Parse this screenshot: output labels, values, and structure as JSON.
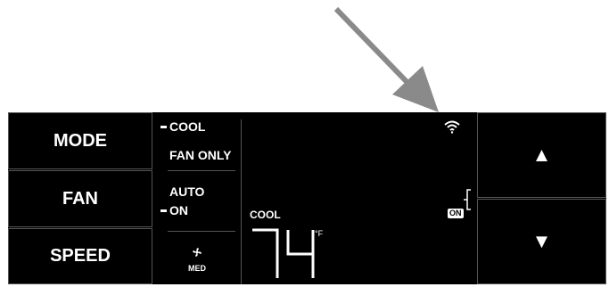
{
  "buttons": {
    "mode": "MODE",
    "fan": "FAN",
    "speed": "SPEED",
    "up_icon": "▲",
    "down_icon": "▼"
  },
  "status": {
    "mode_cool": "COOL",
    "mode_fan_only": "FAN ONLY",
    "fan_auto": "AUTO",
    "fan_on": "ON",
    "speed_label": "MED",
    "selected_mode": "COOL",
    "selected_fan": "ON"
  },
  "display": {
    "mode_label": "COOL",
    "temperature": "74",
    "unit": "°F",
    "power_badge": "ON",
    "wifi_icon": "wifi-icon"
  },
  "colors": {
    "panel_bg": "#000000",
    "text": "#ffffff",
    "divider": "#555555",
    "arrow": "#8a8a8a"
  }
}
